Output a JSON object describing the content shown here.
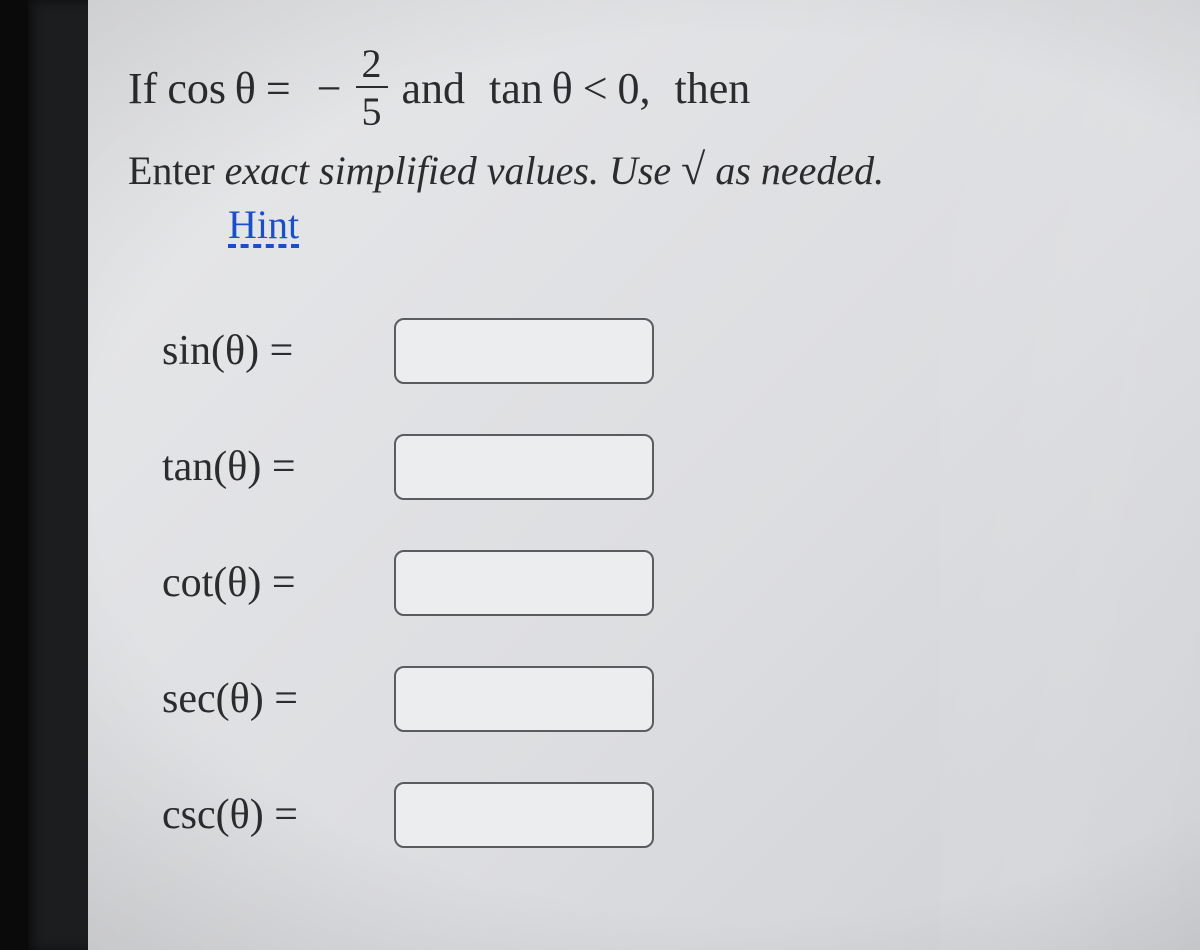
{
  "prompt": {
    "prefix": "If",
    "cos": "cos θ",
    "eq": "=",
    "minus": "−",
    "num": "2",
    "den": "5",
    "between": "and",
    "tan": "tan θ",
    "lt": "<",
    "zero": "0,",
    "suffix": "then"
  },
  "instructions": {
    "before": "Enter ",
    "exact": "exact",
    "mid": " simplified values. Use ",
    "sqrt": "√",
    "after": " as needed."
  },
  "hint": "Hint",
  "fields": [
    {
      "label": "sin(θ) =",
      "value": ""
    },
    {
      "label": "tan(θ) =",
      "value": ""
    },
    {
      "label": "cot(θ) =",
      "value": ""
    },
    {
      "label": "sec(θ) =",
      "value": ""
    },
    {
      "label": "csc(θ) =",
      "value": ""
    }
  ]
}
